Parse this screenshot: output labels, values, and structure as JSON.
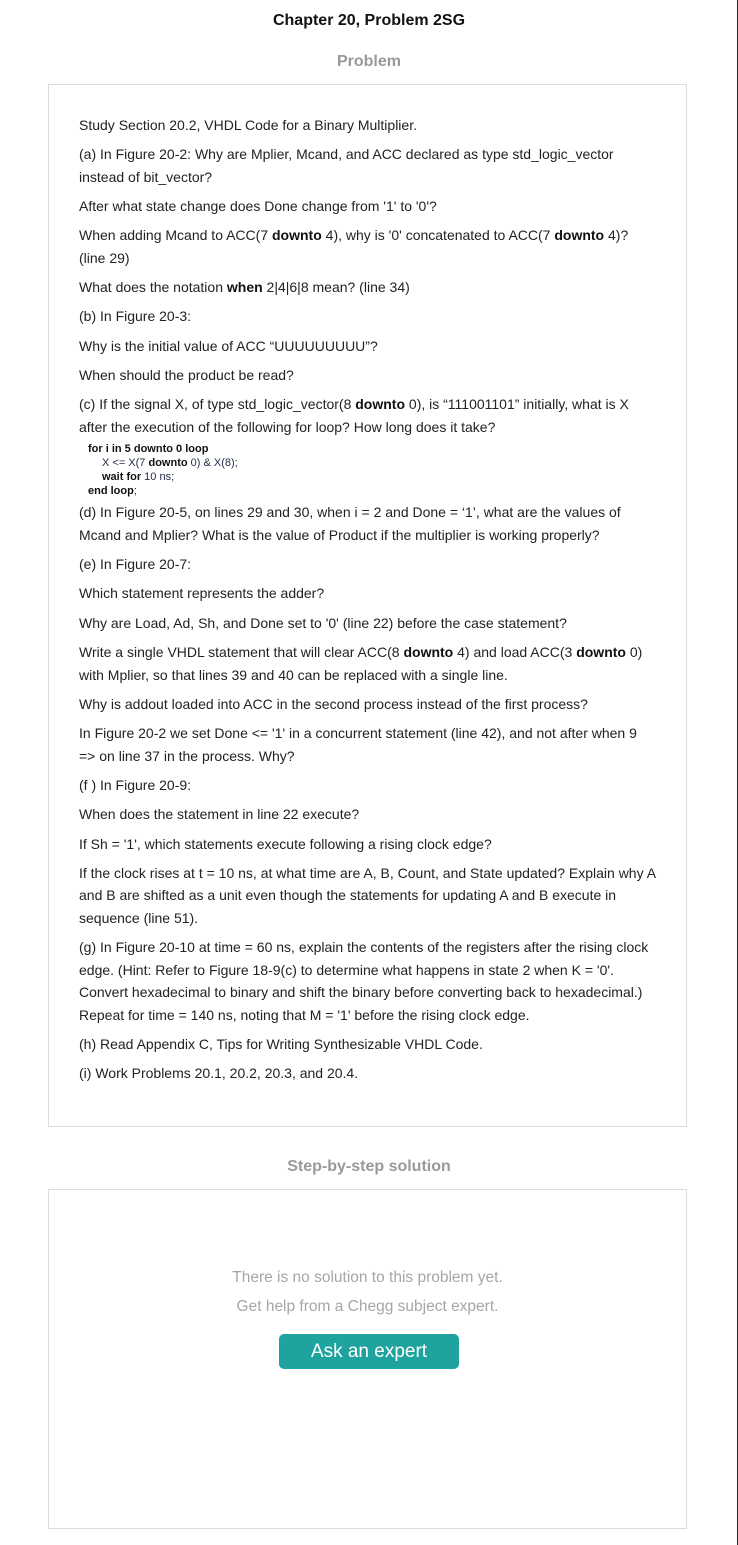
{
  "page": {
    "title": "Chapter 20, Problem 2SG"
  },
  "problem": {
    "heading": "Problem",
    "p1": "Study Section 20.2, VHDL Code for a Binary Multiplier.",
    "p2": "(a) In Figure 20-2: Why are Mplier, Mcand, and ACC declared as type std_logic_vector instead of bit_vector?",
    "p3": "After what state change does Done change from '1' to '0'?",
    "p4": {
      "a": "When adding Mcand to ACC(7 ",
      "b": "downto",
      "c": " 4), why is '0' concatenated to ACC(7 ",
      "d": "downto",
      "e": " 4)? (line 29)"
    },
    "p5": {
      "a": "What does the notation ",
      "b": "when",
      "c": " 2|4|6|8 mean? (line 34)"
    },
    "p6": "(b) In Figure 20-3:",
    "p7": "Why is the initial value of ACC “UUUUUUUUU”?",
    "p8": "When should the product be read?",
    "p9": {
      "a": "(c) If the signal X, of type std_logic_vector(8 ",
      "b": "downto",
      "c": " 0), is “111001101” initially, what is X after the execution of the following for loop? How long does it take?"
    },
    "code": {
      "l1": {
        "kw": "for",
        "m1": " i ",
        "kw2": "in",
        "m2": " 5 ",
        "kw3": "downto",
        "m3": " 0 ",
        "kw4": "loop"
      },
      "l2": {
        "a": "X <= X(7 ",
        "kw": "downto",
        "b": " 0) & X(8);"
      },
      "l3": {
        "kw": "wait for",
        "b": " 10 ns;"
      },
      "l4": {
        "kw": "end loop",
        "b": ";"
      }
    },
    "p10": "(d) In Figure 20-5, on lines 29 and 30, when i = 2 and Done = ‘1’, what are the values of Mcand and Mplier? What is the value of Product if the multiplier is working properly?",
    "p11": "(e) In Figure 20-7:",
    "p12": "Which statement represents the adder?",
    "p13": "Why are Load, Ad, Sh, and Done set to '0' (line 22) before the case statement?",
    "p14": {
      "a": "Write a single VHDL statement that will clear ACC(8 ",
      "b": "downto",
      "c": " 4) and load ACC(3 ",
      "d": "downto",
      "e": " 0) with Mplier, so that lines 39 and 40 can be replaced with a single line."
    },
    "p15": "Why is addout loaded into ACC in the second process instead of the first process?",
    "p16": "In Figure 20-2 we set Done <= '1' in a concurrent statement (line 42), and not after when 9 => on line 37 in the process. Why?",
    "p17": "(f ) In Figure 20-9:",
    "p18": "When does the statement in line 22 execute?",
    "p19": "If Sh = '1', which statements execute following a rising clock edge?",
    "p20": "If the clock rises at t = 10 ns, at what time are A, B, Count, and State updated? Explain why A and B are shifted as a unit even though the statements for updating A and B execute in sequence (line 51).",
    "p21": "(g) In Figure 20-10 at time = 60 ns, explain the contents of the registers after the rising clock edge. (Hint: Refer to Figure 18-9(c) to determine what happens in state 2 when K = '0'. Convert hexadecimal to binary and shift the binary before converting back to hexadecimal.) Repeat for time = 140 ns, noting that M = '1' before the rising clock edge.",
    "p22": "(h) Read Appendix C, Tips for Writing Synthesizable VHDL Code.",
    "p23": "(i) Work Problems 20.1, 20.2, 20.3, and 20.4."
  },
  "solution": {
    "heading": "Step-by-step solution",
    "empty_line1": "There is no solution to this problem yet.",
    "empty_line2": "Get help from a Chegg subject expert.",
    "button_label": "Ask an expert"
  },
  "colors": {
    "accent": "#1fa39e",
    "heading_gray": "#999999",
    "border": "#dcdcdc"
  }
}
